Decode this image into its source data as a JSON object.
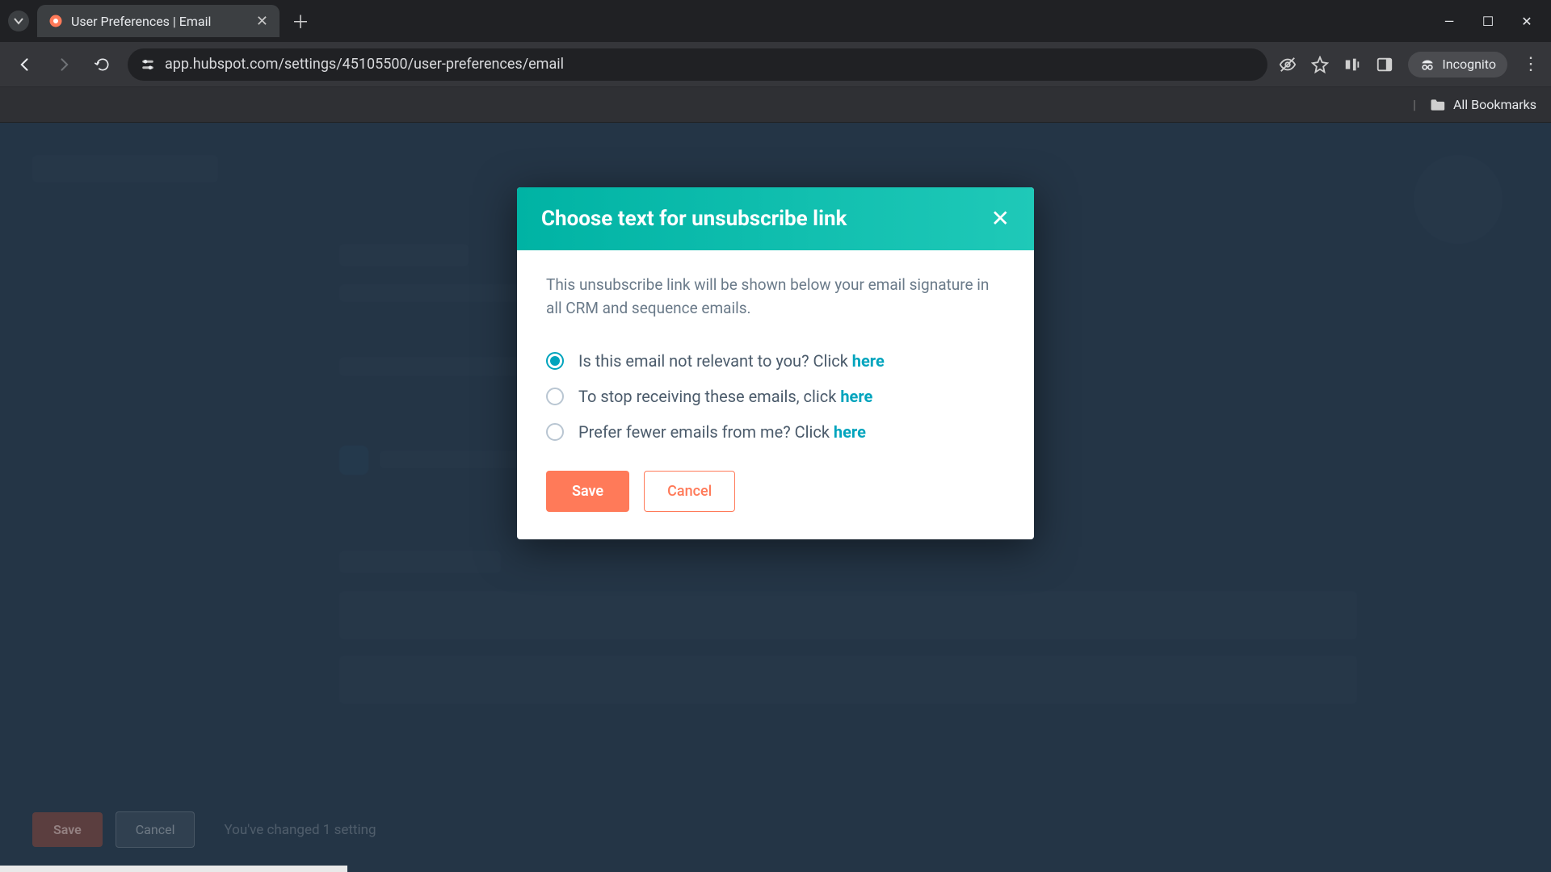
{
  "browser": {
    "tab_title": "User Preferences | Email",
    "url": "app.hubspot.com/settings/45105500/user-preferences/email",
    "incognito_label": "Incognito",
    "all_bookmarks": "All Bookmarks"
  },
  "modal": {
    "title": "Choose text for unsubscribe link",
    "description": "This unsubscribe link will be shown below your email signature in all CRM and sequence emails.",
    "options": [
      {
        "text": "Is this email not relevant to you? Click ",
        "link": "here",
        "selected": true
      },
      {
        "text": "To stop receiving these emails, click ",
        "link": "here",
        "selected": false
      },
      {
        "text": "Prefer fewer emails from me? Click ",
        "link": "here",
        "selected": false
      }
    ],
    "save_label": "Save",
    "cancel_label": "Cancel"
  },
  "background_bar": {
    "save_label": "Save",
    "cancel_label": "Cancel",
    "status_text": "You've changed 1 setting"
  }
}
